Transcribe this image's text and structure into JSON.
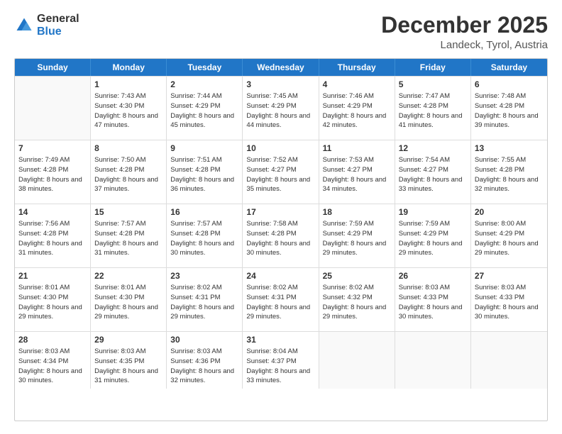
{
  "logo": {
    "general": "General",
    "blue": "Blue"
  },
  "header": {
    "month_year": "December 2025",
    "location": "Landeck, Tyrol, Austria"
  },
  "days_of_week": [
    "Sunday",
    "Monday",
    "Tuesday",
    "Wednesday",
    "Thursday",
    "Friday",
    "Saturday"
  ],
  "weeks": [
    [
      {
        "day": "",
        "sunrise": "",
        "sunset": "",
        "daylight": ""
      },
      {
        "day": "1",
        "sunrise": "Sunrise: 7:43 AM",
        "sunset": "Sunset: 4:30 PM",
        "daylight": "Daylight: 8 hours and 47 minutes."
      },
      {
        "day": "2",
        "sunrise": "Sunrise: 7:44 AM",
        "sunset": "Sunset: 4:29 PM",
        "daylight": "Daylight: 8 hours and 45 minutes."
      },
      {
        "day": "3",
        "sunrise": "Sunrise: 7:45 AM",
        "sunset": "Sunset: 4:29 PM",
        "daylight": "Daylight: 8 hours and 44 minutes."
      },
      {
        "day": "4",
        "sunrise": "Sunrise: 7:46 AM",
        "sunset": "Sunset: 4:29 PM",
        "daylight": "Daylight: 8 hours and 42 minutes."
      },
      {
        "day": "5",
        "sunrise": "Sunrise: 7:47 AM",
        "sunset": "Sunset: 4:28 PM",
        "daylight": "Daylight: 8 hours and 41 minutes."
      },
      {
        "day": "6",
        "sunrise": "Sunrise: 7:48 AM",
        "sunset": "Sunset: 4:28 PM",
        "daylight": "Daylight: 8 hours and 39 minutes."
      }
    ],
    [
      {
        "day": "7",
        "sunrise": "Sunrise: 7:49 AM",
        "sunset": "Sunset: 4:28 PM",
        "daylight": "Daylight: 8 hours and 38 minutes."
      },
      {
        "day": "8",
        "sunrise": "Sunrise: 7:50 AM",
        "sunset": "Sunset: 4:28 PM",
        "daylight": "Daylight: 8 hours and 37 minutes."
      },
      {
        "day": "9",
        "sunrise": "Sunrise: 7:51 AM",
        "sunset": "Sunset: 4:28 PM",
        "daylight": "Daylight: 8 hours and 36 minutes."
      },
      {
        "day": "10",
        "sunrise": "Sunrise: 7:52 AM",
        "sunset": "Sunset: 4:27 PM",
        "daylight": "Daylight: 8 hours and 35 minutes."
      },
      {
        "day": "11",
        "sunrise": "Sunrise: 7:53 AM",
        "sunset": "Sunset: 4:27 PM",
        "daylight": "Daylight: 8 hours and 34 minutes."
      },
      {
        "day": "12",
        "sunrise": "Sunrise: 7:54 AM",
        "sunset": "Sunset: 4:27 PM",
        "daylight": "Daylight: 8 hours and 33 minutes."
      },
      {
        "day": "13",
        "sunrise": "Sunrise: 7:55 AM",
        "sunset": "Sunset: 4:28 PM",
        "daylight": "Daylight: 8 hours and 32 minutes."
      }
    ],
    [
      {
        "day": "14",
        "sunrise": "Sunrise: 7:56 AM",
        "sunset": "Sunset: 4:28 PM",
        "daylight": "Daylight: 8 hours and 31 minutes."
      },
      {
        "day": "15",
        "sunrise": "Sunrise: 7:57 AM",
        "sunset": "Sunset: 4:28 PM",
        "daylight": "Daylight: 8 hours and 31 minutes."
      },
      {
        "day": "16",
        "sunrise": "Sunrise: 7:57 AM",
        "sunset": "Sunset: 4:28 PM",
        "daylight": "Daylight: 8 hours and 30 minutes."
      },
      {
        "day": "17",
        "sunrise": "Sunrise: 7:58 AM",
        "sunset": "Sunset: 4:28 PM",
        "daylight": "Daylight: 8 hours and 30 minutes."
      },
      {
        "day": "18",
        "sunrise": "Sunrise: 7:59 AM",
        "sunset": "Sunset: 4:29 PM",
        "daylight": "Daylight: 8 hours and 29 minutes."
      },
      {
        "day": "19",
        "sunrise": "Sunrise: 7:59 AM",
        "sunset": "Sunset: 4:29 PM",
        "daylight": "Daylight: 8 hours and 29 minutes."
      },
      {
        "day": "20",
        "sunrise": "Sunrise: 8:00 AM",
        "sunset": "Sunset: 4:29 PM",
        "daylight": "Daylight: 8 hours and 29 minutes."
      }
    ],
    [
      {
        "day": "21",
        "sunrise": "Sunrise: 8:01 AM",
        "sunset": "Sunset: 4:30 PM",
        "daylight": "Daylight: 8 hours and 29 minutes."
      },
      {
        "day": "22",
        "sunrise": "Sunrise: 8:01 AM",
        "sunset": "Sunset: 4:30 PM",
        "daylight": "Daylight: 8 hours and 29 minutes."
      },
      {
        "day": "23",
        "sunrise": "Sunrise: 8:02 AM",
        "sunset": "Sunset: 4:31 PM",
        "daylight": "Daylight: 8 hours and 29 minutes."
      },
      {
        "day": "24",
        "sunrise": "Sunrise: 8:02 AM",
        "sunset": "Sunset: 4:31 PM",
        "daylight": "Daylight: 8 hours and 29 minutes."
      },
      {
        "day": "25",
        "sunrise": "Sunrise: 8:02 AM",
        "sunset": "Sunset: 4:32 PM",
        "daylight": "Daylight: 8 hours and 29 minutes."
      },
      {
        "day": "26",
        "sunrise": "Sunrise: 8:03 AM",
        "sunset": "Sunset: 4:33 PM",
        "daylight": "Daylight: 8 hours and 30 minutes."
      },
      {
        "day": "27",
        "sunrise": "Sunrise: 8:03 AM",
        "sunset": "Sunset: 4:33 PM",
        "daylight": "Daylight: 8 hours and 30 minutes."
      }
    ],
    [
      {
        "day": "28",
        "sunrise": "Sunrise: 8:03 AM",
        "sunset": "Sunset: 4:34 PM",
        "daylight": "Daylight: 8 hours and 30 minutes."
      },
      {
        "day": "29",
        "sunrise": "Sunrise: 8:03 AM",
        "sunset": "Sunset: 4:35 PM",
        "daylight": "Daylight: 8 hours and 31 minutes."
      },
      {
        "day": "30",
        "sunrise": "Sunrise: 8:03 AM",
        "sunset": "Sunset: 4:36 PM",
        "daylight": "Daylight: 8 hours and 32 minutes."
      },
      {
        "day": "31",
        "sunrise": "Sunrise: 8:04 AM",
        "sunset": "Sunset: 4:37 PM",
        "daylight": "Daylight: 8 hours and 33 minutes."
      },
      {
        "day": "",
        "sunrise": "",
        "sunset": "",
        "daylight": ""
      },
      {
        "day": "",
        "sunrise": "",
        "sunset": "",
        "daylight": ""
      },
      {
        "day": "",
        "sunrise": "",
        "sunset": "",
        "daylight": ""
      }
    ]
  ]
}
